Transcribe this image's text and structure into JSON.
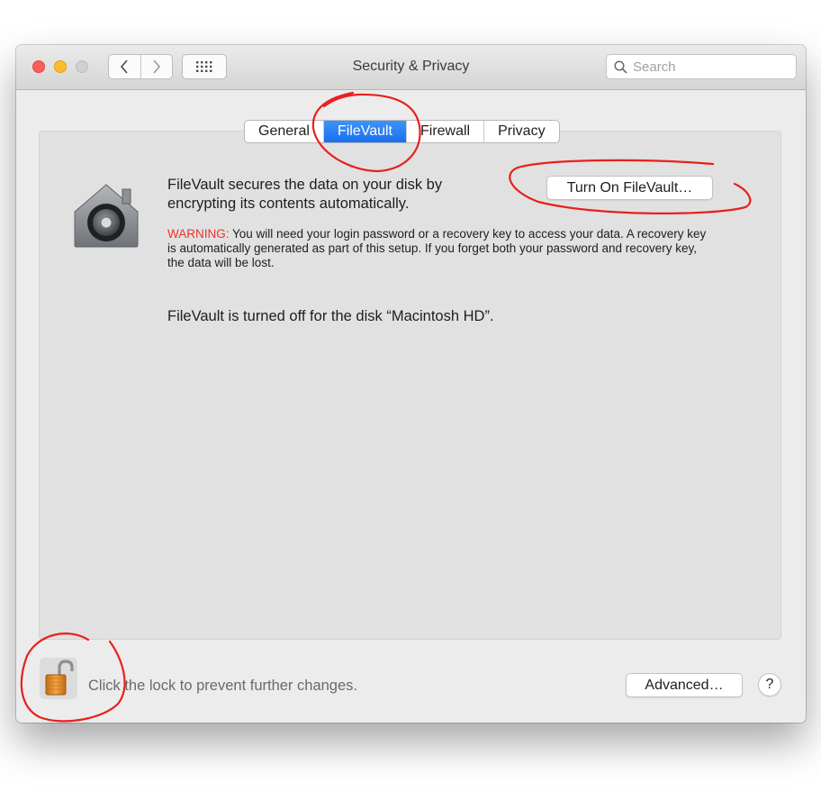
{
  "window": {
    "title": "Security & Privacy"
  },
  "toolbar": {
    "back_icon": "chevron-left-icon",
    "forward_icon": "chevron-right-icon",
    "grid_icon": "show-all-grid-icon"
  },
  "search": {
    "placeholder": "Search"
  },
  "tabs": [
    {
      "label": "General",
      "active": false
    },
    {
      "label": "FileVault",
      "active": true
    },
    {
      "label": "Firewall",
      "active": false
    },
    {
      "label": "Privacy",
      "active": false
    }
  ],
  "filevault": {
    "description": "FileVault secures the data on your disk by encrypting its contents automatically.",
    "turn_on_label": "Turn On FileVault…",
    "warning_label": "WARNING:",
    "warning_text": " You will need your login password or a recovery key to access your data. A recovery key is automatically generated as part of this setup. If you forget both your password and recovery key, the data will be lost.",
    "status": "FileVault is turned off for the disk “Macintosh HD”."
  },
  "footer": {
    "lock_text": "Click the lock to prevent further changes.",
    "advanced_label": "Advanced…",
    "help_label": "?"
  },
  "colors": {
    "accent": "#1a6ff0",
    "warning": "#f0302c",
    "annotation": "#e8201c"
  }
}
